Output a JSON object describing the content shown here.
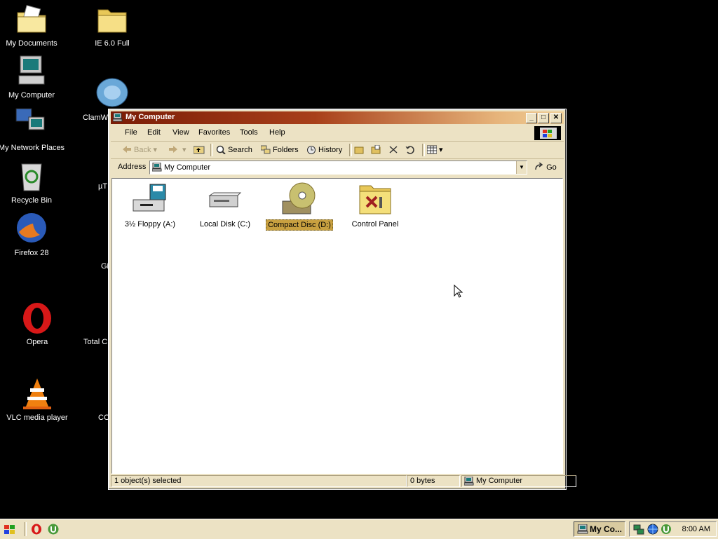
{
  "desktop": {
    "icons": [
      {
        "label": "My Documents"
      },
      {
        "label": "IE 6.0 Full"
      },
      {
        "label": "My Computer"
      },
      {
        "label": "ClamWi"
      },
      {
        "label": "My Network Places"
      },
      {
        "label": "µT"
      },
      {
        "label": "Recycle Bin"
      },
      {
        "label": "Firefox 28"
      },
      {
        "label": "Gi"
      },
      {
        "label": "Opera"
      },
      {
        "label": "Total C"
      },
      {
        "label": "VLC media player"
      },
      {
        "label": "CC"
      }
    ]
  },
  "window": {
    "title": "My Computer",
    "menu": [
      "File",
      "Edit",
      "View",
      "Favorites",
      "Tools",
      "Help"
    ],
    "toolbar": {
      "back": "Back",
      "search": "Search",
      "folders": "Folders",
      "history": "History"
    },
    "address": {
      "label": "Address",
      "value": "My Computer",
      "go": "Go"
    },
    "items": [
      {
        "label": "3½ Floppy (A:)",
        "icon": "floppy-drive-icon",
        "selected": false
      },
      {
        "label": "Local Disk (C:)",
        "icon": "hard-disk-icon",
        "selected": false
      },
      {
        "label": "Compact Disc (D:)",
        "icon": "cd-drive-icon",
        "selected": true
      },
      {
        "label": "Control Panel",
        "icon": "control-panel-icon",
        "selected": false
      }
    ],
    "status": {
      "selected": "1 object(s) selected",
      "size": "0 bytes",
      "zone": "My Computer"
    }
  },
  "taskbar": {
    "task_label": "My Co...",
    "clock": "8:00 AM"
  },
  "colors": {
    "desktop": "#000000",
    "window_face": "#ece2c4",
    "title_start": "#7a1c06",
    "title_end": "#f0d098",
    "selection": "#c8a040"
  }
}
